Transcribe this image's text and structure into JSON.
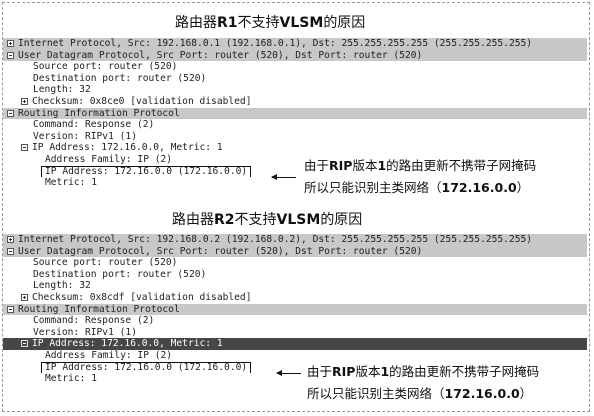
{
  "captures": [
    {
      "title_prefix": "路由器",
      "title_router": "R1",
      "title_mid": "不支持",
      "title_tech": "VLSM",
      "title_suffix": "的原因",
      "rows": [
        "Internet Protocol, Src: 192.168.0.1 (192.168.0.1), Dst: 255.255.255.255 (255.255.255.255)",
        "User Datagram Protocol, Src Port: router (520), Dst Port: router (520)",
        "Source port: router (520)",
        "Destination port: router (520)",
        "Length: 32",
        "Checksum: 0x8ce0 [validation disabled]",
        "Routing Information Protocol",
        "Command: Response (2)",
        "Version: RIPv1 (1)",
        "IP Address: 172.16.0.0, Metric: 1",
        "Address Family: IP (2)",
        "IP Address: 172.16.0.0 (172.16.0.0)",
        "Metric: 1"
      ],
      "note_line1_a": "由于",
      "note_line1_b": "RIP",
      "note_line1_c": "版本",
      "note_line1_d": "1",
      "note_line1_e": "的路由更新不携带子网掩码",
      "note_line2_a": "所以只能识别主类网络（",
      "note_line2_b": "172.16.0.0",
      "note_line2_c": "）"
    },
    {
      "title_prefix": "路由器",
      "title_router": "R2",
      "title_mid": "不支持",
      "title_tech": "VLSM",
      "title_suffix": "的原因",
      "rows": [
        "Internet Protocol, Src: 192.168.0.2 (192.168.0.2), Dst: 255.255.255.255 (255.255.255.255)",
        "User Datagram Protocol, Src Port: router (520), Dst Port: router (520)",
        "Source port: router (520)",
        "Destination port: router (520)",
        "Length: 32",
        "Checksum: 0x8cdf [validation disabled]",
        "Routing Information Protocol",
        "Command: Response (2)",
        "Version: RIPv1 (1)",
        "IP Address: 172.16.0.0, Metric: 1",
        "Address Family: IP (2)",
        "IP Address: 172.16.0.0 (172.16.0.0)",
        "Metric: 1"
      ],
      "note_line1_a": "由于",
      "note_line1_b": "RIP",
      "note_line1_c": "版本",
      "note_line1_d": "1",
      "note_line1_e": "的路由更新不携带子网掩码",
      "note_line2_a": "所以只能识别主类网络（",
      "note_line2_b": "172.16.0.0",
      "note_line2_c": "）"
    }
  ]
}
